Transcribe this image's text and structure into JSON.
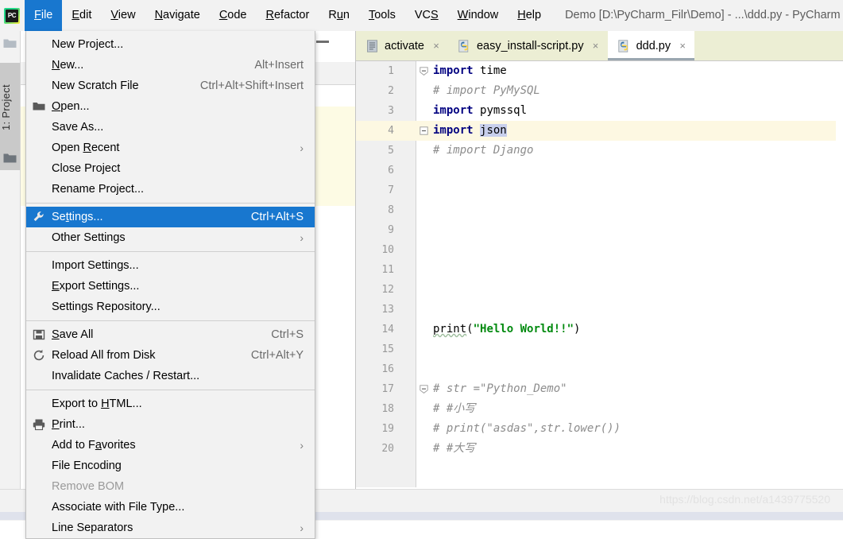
{
  "window": {
    "title": "Demo [D:\\PyCharm_Filr\\Demo] - ...\\ddd.py - PyCharm",
    "app_logo": "pycharm-logo"
  },
  "menubar": {
    "items": [
      {
        "label": "File",
        "mnemonic": "F",
        "active": true
      },
      {
        "label": "Edit",
        "mnemonic": "E",
        "active": false
      },
      {
        "label": "View",
        "mnemonic": "V",
        "active": false
      },
      {
        "label": "Navigate",
        "mnemonic": "N",
        "active": false
      },
      {
        "label": "Code",
        "mnemonic": "C",
        "active": false
      },
      {
        "label": "Refactor",
        "mnemonic": "R",
        "active": false
      },
      {
        "label": "Run",
        "mnemonic": "u",
        "active": false
      },
      {
        "label": "Tools",
        "mnemonic": "T",
        "active": false
      },
      {
        "label": "VCS",
        "mnemonic": "S",
        "active": false
      },
      {
        "label": "Window",
        "mnemonic": "W",
        "active": false
      },
      {
        "label": "Help",
        "mnemonic": "H",
        "active": false
      }
    ]
  },
  "file_menu": {
    "groups": [
      {
        "items": [
          {
            "label": "New Project...",
            "shortcut": "",
            "icon": "",
            "arrow": false,
            "selected": false,
            "disabled": false
          },
          {
            "label": "New...",
            "shortcut": "Alt+Insert",
            "icon": "",
            "arrow": false,
            "selected": false,
            "disabled": false,
            "mnemonic": "N"
          },
          {
            "label": "New Scratch File",
            "shortcut": "Ctrl+Alt+Shift+Insert",
            "icon": "",
            "arrow": false,
            "selected": false,
            "disabled": false
          },
          {
            "label": "Open...",
            "shortcut": "",
            "icon": "folder-icon",
            "arrow": false,
            "selected": false,
            "disabled": false,
            "mnemonic": "O"
          },
          {
            "label": "Save As...",
            "shortcut": "",
            "icon": "",
            "arrow": false,
            "selected": false,
            "disabled": false
          },
          {
            "label": "Open Recent",
            "shortcut": "",
            "icon": "",
            "arrow": true,
            "selected": false,
            "disabled": false,
            "mnemonic": "R"
          },
          {
            "label": "Close Project",
            "shortcut": "",
            "icon": "",
            "arrow": false,
            "selected": false,
            "disabled": false
          },
          {
            "label": "Rename Project...",
            "shortcut": "",
            "icon": "",
            "arrow": false,
            "selected": false,
            "disabled": false
          }
        ]
      },
      {
        "items": [
          {
            "label": "Settings...",
            "shortcut": "Ctrl+Alt+S",
            "icon": "wrench-icon",
            "arrow": false,
            "selected": true,
            "disabled": false,
            "mnemonic": "t"
          },
          {
            "label": "Other Settings",
            "shortcut": "",
            "icon": "",
            "arrow": true,
            "selected": false,
            "disabled": false
          }
        ]
      },
      {
        "items": [
          {
            "label": "Import Settings...",
            "shortcut": "",
            "icon": "",
            "arrow": false,
            "selected": false,
            "disabled": false
          },
          {
            "label": "Export Settings...",
            "shortcut": "",
            "icon": "",
            "arrow": false,
            "selected": false,
            "disabled": false,
            "mnemonic": "E"
          },
          {
            "label": "Settings Repository...",
            "shortcut": "",
            "icon": "",
            "arrow": false,
            "selected": false,
            "disabled": false
          }
        ]
      },
      {
        "items": [
          {
            "label": "Save All",
            "shortcut": "Ctrl+S",
            "icon": "save-icon",
            "arrow": false,
            "selected": false,
            "disabled": false,
            "mnemonic": "S"
          },
          {
            "label": "Reload All from Disk",
            "shortcut": "Ctrl+Alt+Y",
            "icon": "refresh-icon",
            "arrow": false,
            "selected": false,
            "disabled": false
          },
          {
            "label": "Invalidate Caches / Restart...",
            "shortcut": "",
            "icon": "",
            "arrow": false,
            "selected": false,
            "disabled": false
          }
        ]
      },
      {
        "items": [
          {
            "label": "Export to HTML...",
            "shortcut": "",
            "icon": "",
            "arrow": false,
            "selected": false,
            "disabled": false,
            "mnemonic": "H"
          },
          {
            "label": "Print...",
            "shortcut": "",
            "icon": "printer-icon",
            "arrow": false,
            "selected": false,
            "disabled": false,
            "mnemonic": "P"
          },
          {
            "label": "Add to Favorites",
            "shortcut": "",
            "icon": "",
            "arrow": true,
            "selected": false,
            "disabled": false,
            "mnemonic": "a"
          },
          {
            "label": "File Encoding",
            "shortcut": "",
            "icon": "",
            "arrow": false,
            "selected": false,
            "disabled": false
          },
          {
            "label": "Remove BOM",
            "shortcut": "",
            "icon": "",
            "arrow": false,
            "selected": false,
            "disabled": true
          },
          {
            "label": "Associate with File Type...",
            "shortcut": "",
            "icon": "",
            "arrow": false,
            "selected": false,
            "disabled": false
          },
          {
            "label": "Line Separators",
            "shortcut": "",
            "icon": "",
            "arrow": true,
            "selected": false,
            "disabled": false
          }
        ]
      }
    ]
  },
  "tool_window": {
    "project_tab_label": "1: Project",
    "top_icon": "folder-icon",
    "tab_icon": "folder-icon",
    "header_icons": [
      "gear-icon",
      "minimize-icon"
    ]
  },
  "editor": {
    "tabs": [
      {
        "label": "activate",
        "icon": "file-icon",
        "selected": false,
        "close": "×"
      },
      {
        "label": "easy_install-script.py",
        "icon": "python-icon",
        "selected": false,
        "close": "×"
      },
      {
        "label": "ddd.py",
        "icon": "python-icon",
        "selected": true,
        "close": "×"
      }
    ],
    "lines": [
      {
        "n": "1",
        "fold": "open",
        "highlight": false
      },
      {
        "n": "2",
        "fold": "",
        "highlight": false
      },
      {
        "n": "3",
        "fold": "",
        "highlight": false
      },
      {
        "n": "4",
        "fold": "close",
        "highlight": true
      },
      {
        "n": "5",
        "fold": "",
        "highlight": false
      },
      {
        "n": "6",
        "fold": "",
        "highlight": false
      },
      {
        "n": "7",
        "fold": "",
        "highlight": false
      },
      {
        "n": "8",
        "fold": "",
        "highlight": false
      },
      {
        "n": "9",
        "fold": "",
        "highlight": false
      },
      {
        "n": "10",
        "fold": "",
        "highlight": false
      },
      {
        "n": "11",
        "fold": "",
        "highlight": false
      },
      {
        "n": "12",
        "fold": "",
        "highlight": false
      },
      {
        "n": "13",
        "fold": "",
        "highlight": false
      },
      {
        "n": "14",
        "fold": "",
        "highlight": false
      },
      {
        "n": "15",
        "fold": "",
        "highlight": false
      },
      {
        "n": "16",
        "fold": "",
        "highlight": false
      },
      {
        "n": "17",
        "fold": "open",
        "highlight": false
      },
      {
        "n": "18",
        "fold": "",
        "highlight": false
      },
      {
        "n": "19",
        "fold": "",
        "highlight": false
      },
      {
        "n": "20",
        "fold": "",
        "highlight": false
      }
    ],
    "code_text": [
      "import time",
      "# import PyMySQL",
      "import pymssql",
      "import json",
      "# import Django",
      "",
      "",
      "",
      "",
      "",
      "",
      "",
      "",
      "print(\"Hello World!!\")",
      "",
      "",
      "# str =\"Python_Demo\"",
      "# #小写",
      "# print(\"asdas\",str.lower())",
      "# #大写"
    ]
  },
  "statusbar": {
    "watermark": "https://blog.csdn.net/a1439775520"
  },
  "colors": {
    "accent_selection": "#1877cf",
    "tabbar_bg": "#eceed4",
    "line_highlight": "#fdf8e2",
    "keyword": "#000080",
    "comment": "#8c8c8c",
    "string": "#028a0f",
    "token_selection": "#c8cfec"
  }
}
